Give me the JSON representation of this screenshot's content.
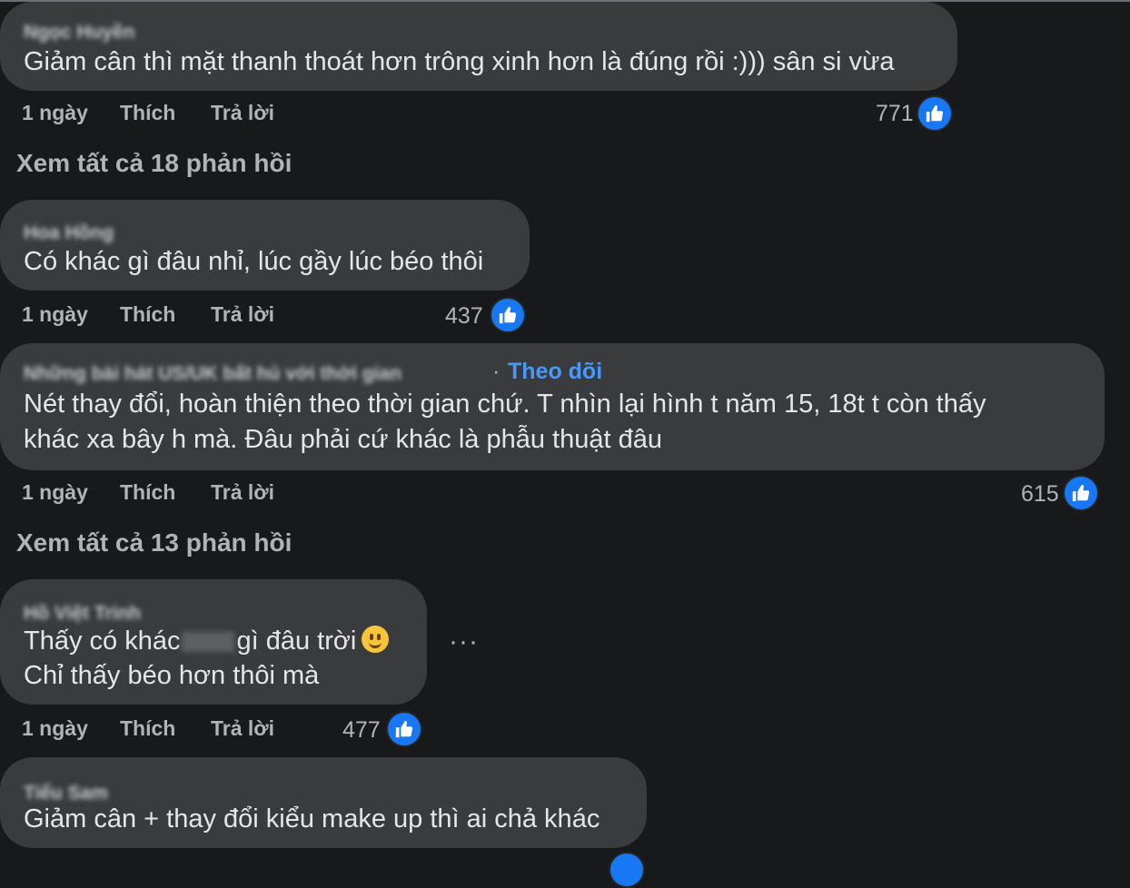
{
  "colors": {
    "background": "#18191a",
    "bubble": "#3a3b3c",
    "like_blue": "#1877f2",
    "follow_blue": "#4599ff"
  },
  "comments": [
    {
      "author": "Ngọc Huyền",
      "lines": [
        "Giảm cân thì mặt thanh thoát hơn trông xinh hơn là đúng rồi :))) sân si vừa"
      ],
      "time": "1 ngày",
      "like": "Thích",
      "reply": "Trả lời",
      "reactions": "771",
      "reaction_icon": "like-icon"
    },
    {
      "author": "Hoa Hồng",
      "lines": [
        "Có khác gì đâu nhỉ, lúc gầy lúc béo thôi"
      ],
      "time": "1 ngày",
      "like": "Thích",
      "reply": "Trả lời",
      "reactions": "437",
      "reaction_icon": "like-icon"
    },
    {
      "author": "Những bài hát US/UK bất hủ với thời gian",
      "follow": "Theo dõi",
      "lines": [
        "Nét thay đổi, hoàn thiện theo thời gian chứ. T nhìn lại hình t năm 15, 18t t còn thấy",
        "khác xa bây h mà. Đâu phải cứ khác là phẫu thuật đâu"
      ],
      "time": "1 ngày",
      "like": "Thích",
      "reply": "Trả lời",
      "reactions": "615",
      "reaction_icon": "like-icon"
    },
    {
      "author": "Hồ Việt Trinh",
      "lines": [
        "Thấy có khác",
        "gì đâu trời",
        "Chỉ thấy béo hơn thôi mà"
      ],
      "time": "1 ngày",
      "like": "Thích",
      "reply": "Trả lời",
      "reactions": "477",
      "reaction_icon": "like-icon",
      "emoji": "smile-icon"
    },
    {
      "author": "Tiểu Sam",
      "lines": [
        "Giảm cân + thay đổi kiểu make up thì ai chả khác"
      ]
    }
  ],
  "view_replies": [
    "Xem tất cả 18 phản hồi",
    "Xem tất cả 13 phản hồi"
  ],
  "more_label": "···"
}
